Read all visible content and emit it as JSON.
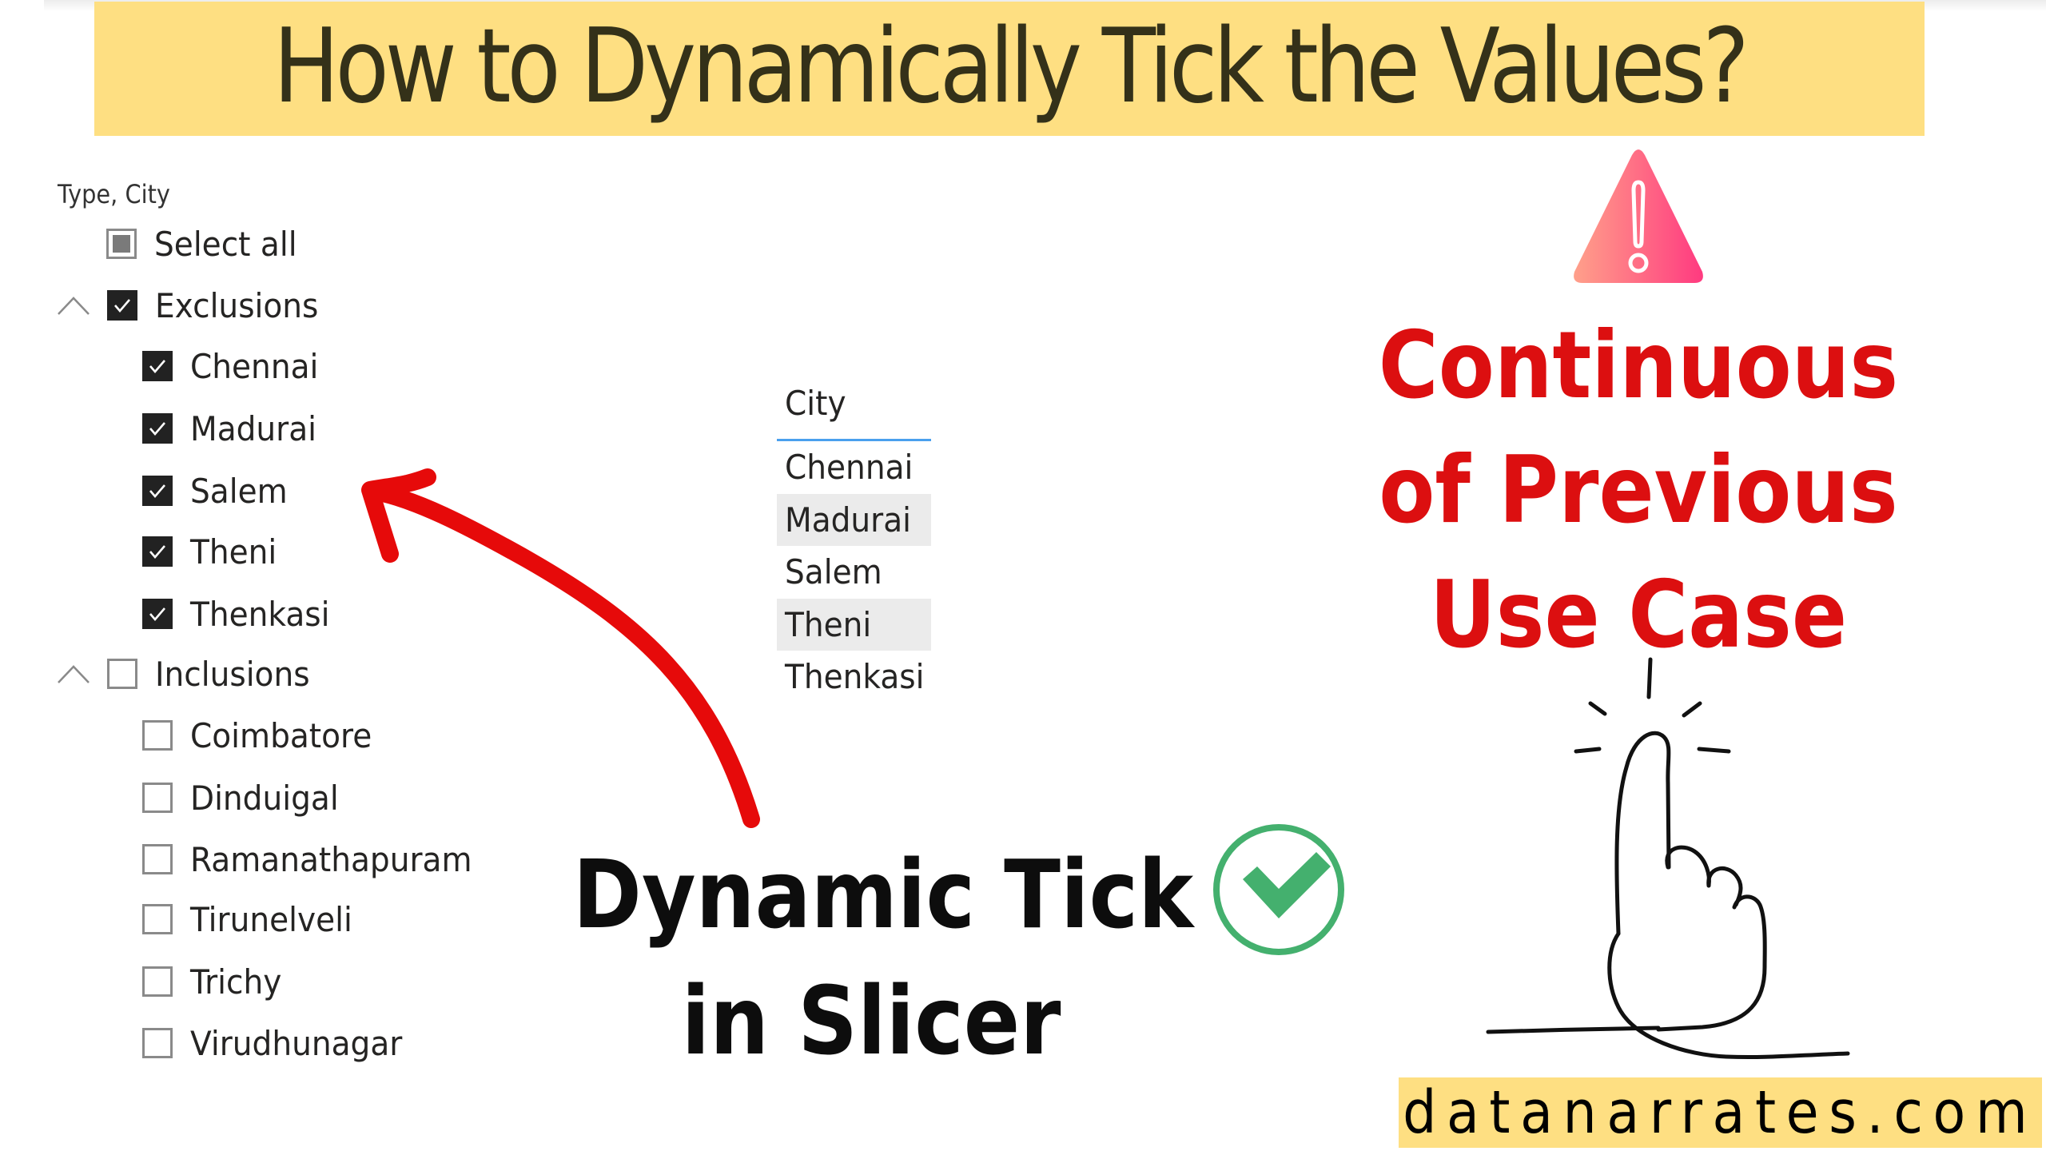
{
  "title": "How to Dynamically Tick the Values?",
  "slicer": {
    "header": "Type, City",
    "select_all": {
      "label": "Select all",
      "state": "partial"
    },
    "groups": [
      {
        "label": "Exclusions",
        "expanded": true,
        "checked": true,
        "items": [
          {
            "label": "Chennai",
            "checked": true
          },
          {
            "label": "Madurai",
            "checked": true
          },
          {
            "label": "Salem",
            "checked": true
          },
          {
            "label": "Theni",
            "checked": true
          },
          {
            "label": "Thenkasi",
            "checked": true
          }
        ]
      },
      {
        "label": "Inclusions",
        "expanded": true,
        "checked": false,
        "items": [
          {
            "label": "Coimbatore",
            "checked": false
          },
          {
            "label": "Dinduigal",
            "checked": false
          },
          {
            "label": "Ramanathapuram",
            "checked": false
          },
          {
            "label": "Tirunelveli",
            "checked": false
          },
          {
            "label": "Trichy",
            "checked": false
          },
          {
            "label": "Virudhunagar",
            "checked": false
          }
        ]
      }
    ]
  },
  "city_table": {
    "header": "City",
    "rows": [
      "Chennai",
      "Madurai",
      "Salem",
      "Theni",
      "Thenkasi"
    ]
  },
  "callout": {
    "line1": "Dynamic Tick",
    "line2": "in Slicer"
  },
  "note": {
    "line1": "Continuous",
    "line2": "of Previous",
    "line3": "Use Case"
  },
  "footer": {
    "site": "datanarrates.com"
  },
  "colors": {
    "banner": "#fedf82",
    "title_text": "#343119",
    "note_red": "#dc0f10",
    "arrow_red": "#e60a0a",
    "check_green": "#44b06e",
    "table_accent": "#4aa0ee",
    "warning_gradient_start": "#ffa08a",
    "warning_gradient_end": "#ff3a80"
  }
}
